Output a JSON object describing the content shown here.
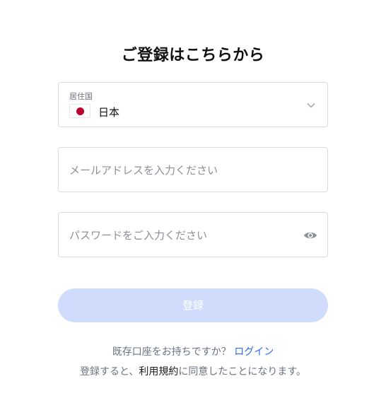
{
  "title": "ご登録はこちらから",
  "country": {
    "label": "居住国",
    "value": "日本",
    "flag_icon": "japan-flag-icon"
  },
  "email": {
    "placeholder": "メールアドレスを入力ください"
  },
  "password": {
    "placeholder": "パスワードをご入力ください",
    "toggle_icon": "eye-icon"
  },
  "submit": {
    "label": "登録",
    "background_color": "#cfdcfb"
  },
  "footer": {
    "login_prompt": "既存口座をお持ちですか？",
    "login_link": "ログイン",
    "terms_prefix": "登録すると、",
    "terms_link": "利用規約",
    "terms_suffix": "に同意したことになります。"
  },
  "colors": {
    "link": "#2d6bf0",
    "muted": "#6b7280",
    "border": "#d9dde3"
  }
}
